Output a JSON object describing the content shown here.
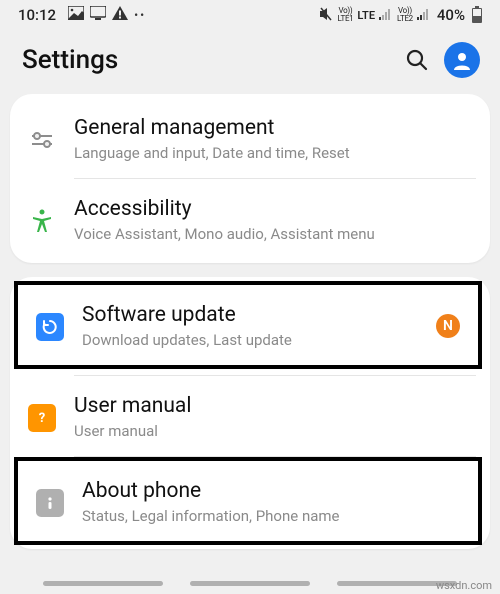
{
  "status": {
    "time": "10:12",
    "indicators_left": [
      "image-icon",
      "cast-icon",
      "warning-icon",
      "more-icon"
    ],
    "vo1": "Vo))",
    "lte1": "LTE1",
    "vo2": "Vo))",
    "lte2": "LTE2",
    "lte_label": "LTE",
    "battery_pct": "40%"
  },
  "header": {
    "title": "Settings"
  },
  "groups": [
    {
      "rows": [
        {
          "id": "general",
          "title": "General management",
          "sub": "Language and input, Date and time, Reset"
        },
        {
          "id": "accessibility",
          "title": "Accessibility",
          "sub": "Voice Assistant, Mono audio, Assistant menu"
        }
      ]
    },
    {
      "rows": [
        {
          "id": "software",
          "title": "Software update",
          "sub": "Download updates, Last update",
          "badge": "N",
          "highlight": true
        },
        {
          "id": "manual",
          "title": "User manual",
          "sub": "User manual"
        },
        {
          "id": "about",
          "title": "About phone",
          "sub": "Status, Legal information, Phone name",
          "highlight": true
        }
      ]
    }
  ],
  "watermark": "wsxdn.com"
}
